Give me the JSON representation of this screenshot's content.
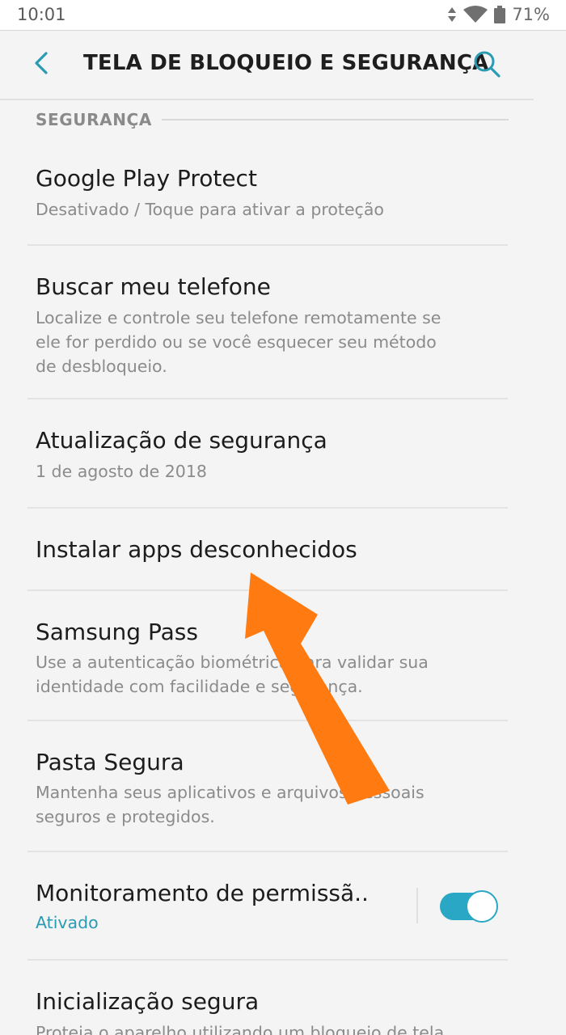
{
  "status_bar": {
    "time": "10:01",
    "battery": "71%",
    "icons": [
      "data-arrows-icon",
      "wifi-icon",
      "battery-icon"
    ]
  },
  "app_bar": {
    "title": "TELA DE BLOQUEIO E SEGURANÇA",
    "back_icon": "chevron-left-icon",
    "search_icon": "search-icon"
  },
  "section": {
    "title": "SEGURANÇA"
  },
  "items": [
    {
      "title": "Google Play Protect",
      "subtitle": [
        "Desativado / Toque para ativar a proteção"
      ]
    },
    {
      "title": "Buscar meu telefone",
      "subtitle": [
        "Localize e controle seu telefone remotamente se",
        "ele for perdido ou se você esquecer seu método",
        "de desbloqueio."
      ]
    },
    {
      "title": "Atualização de segurança",
      "subtitle": [
        "1 de agosto de 2018"
      ]
    },
    {
      "title": "Instalar apps desconhecidos",
      "subtitle": []
    },
    {
      "title": "Samsung Pass",
      "subtitle": [
        "Use a autenticação biométrica para validar sua",
        "identidade com facilidade e segurança."
      ]
    },
    {
      "title": "Pasta Segura",
      "subtitle": [
        "Mantenha seus aplicativos e arquivos pessoais",
        "seguros e protegidos."
      ]
    },
    {
      "title": "Monitoramento de permissã..",
      "subtitle": [
        "Ativado"
      ],
      "toggle_on": true
    },
    {
      "title": "Inicialização segura",
      "subtitle": [
        "Proteja o aparelho utilizando um bloqueio de tela"
      ]
    }
  ],
  "colors": {
    "accent": "#2aa7c4",
    "annotation_arrow": "#ff7a10"
  }
}
